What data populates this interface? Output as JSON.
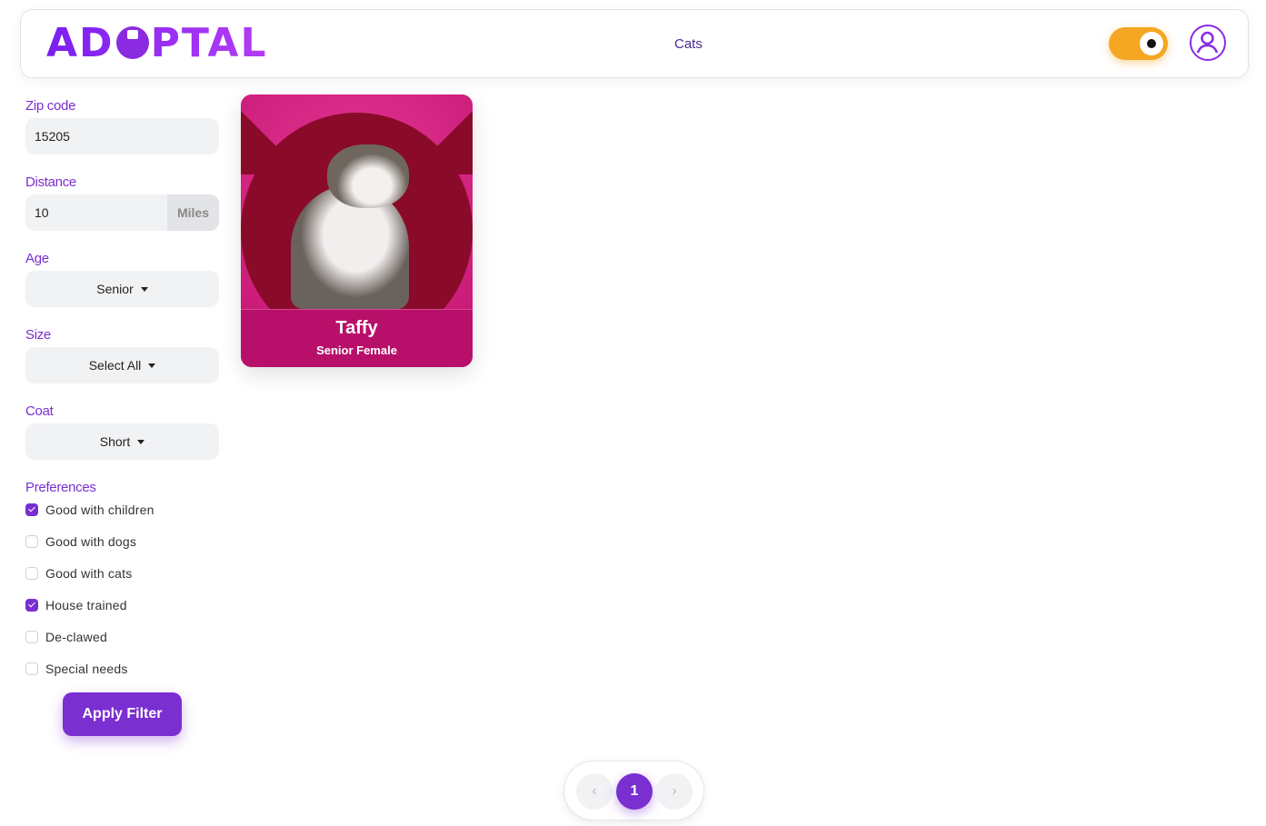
{
  "header": {
    "logo": "ADOPTAL",
    "nav_link": "Cats",
    "theme_toggle_icon": "sun-icon",
    "profile_icon": "user-icon"
  },
  "filters": {
    "zip_label": "Zip code",
    "zip_value": "15205",
    "distance_label": "Distance",
    "distance_value": "10",
    "distance_unit": "Miles",
    "age_label": "Age",
    "age_value": "Senior",
    "size_label": "Size",
    "size_value": "Select All",
    "coat_label": "Coat",
    "coat_value": "Short",
    "preferences_label": "Preferences",
    "preferences": [
      {
        "label": "Good with children",
        "checked": true
      },
      {
        "label": "Good with dogs",
        "checked": false
      },
      {
        "label": "Good with cats",
        "checked": false
      },
      {
        "label": "House trained",
        "checked": true
      },
      {
        "label": "De-clawed",
        "checked": false
      },
      {
        "label": "Special needs",
        "checked": false
      }
    ],
    "apply_label": "Apply Filter"
  },
  "results": [
    {
      "name": "Taffy",
      "details": "Senior Female"
    }
  ],
  "pagination": {
    "prev": "‹",
    "current": "1",
    "next": "›"
  },
  "colors": {
    "accent": "#7a2fd1",
    "toggle": "#f5a623",
    "card": "#b8106a"
  }
}
